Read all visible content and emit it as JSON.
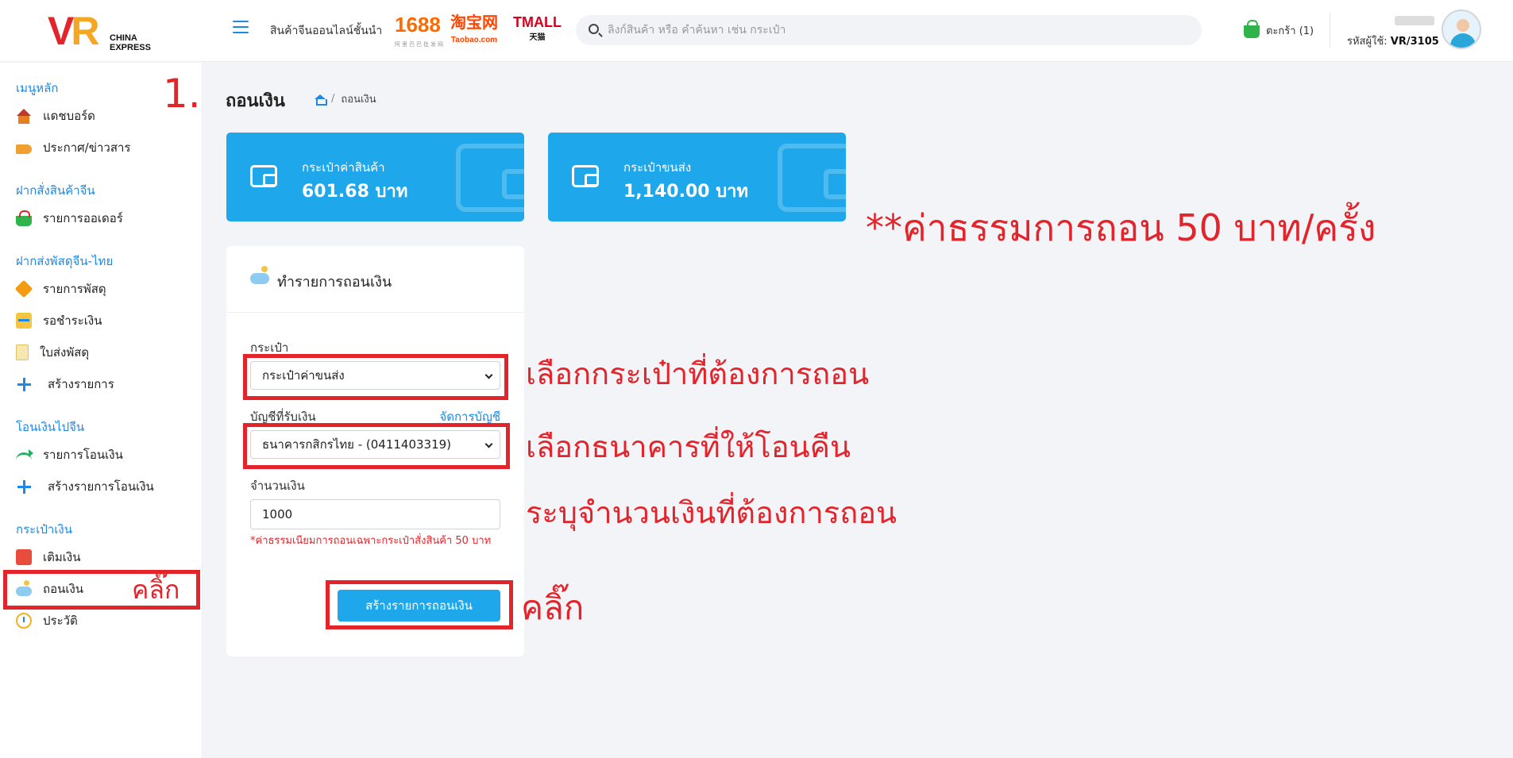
{
  "header": {
    "logo_mark": "VR",
    "logo_line1": "CHINA",
    "logo_line2": "EXPRESS",
    "tagline": "สินค้าจีนออนไลน์ชั้นนำ",
    "brands": [
      {
        "name": "1688",
        "sub": "阿里巴巴批发网"
      },
      {
        "name": "淘宝网",
        "sub": "Taobao.com"
      },
      {
        "name": "TMALL",
        "sub": "天猫"
      }
    ],
    "search_placeholder": "ลิงก์สินค้า หรือ คำค้นหา เช่น กระเป๋า",
    "cart_label": "ตะกร้า (1)",
    "user_code_label": "รหัสผู้ใช้:",
    "user_code": "VR/3105"
  },
  "sidebar": {
    "sections": [
      {
        "title": "เมนูหลัก",
        "items": [
          "แดชบอร์ด",
          "ประกาศ/ข่าวสาร"
        ]
      },
      {
        "title": "ฝากสั่งสินค้าจีน",
        "items": [
          "รายการออเดอร์"
        ]
      },
      {
        "title": "ฝากส่งพัสดุจีน-ไทย",
        "items": [
          "รายการพัสดุ",
          "รอชำระเงิน",
          "ใบส่งพัสดุ",
          "สร้างรายการ"
        ]
      },
      {
        "title": "โอนเงินไปจีน",
        "items": [
          "รายการโอนเงิน",
          "สร้างรายการโอนเงิน"
        ]
      },
      {
        "title": "กระเป๋าเงิน",
        "items": [
          "เติมเงิน",
          "ถอนเงิน",
          "ประวัติ"
        ]
      }
    ]
  },
  "main": {
    "page_title": "ถอนเงิน",
    "breadcrumb_current": "ถอนเงิน",
    "breadcrumb_sep": "/",
    "wallets": [
      {
        "label": "กระเป๋าค่าสินค้า",
        "amount": "601.68 บาท"
      },
      {
        "label": "กระเป๋าขนส่ง",
        "amount": "1,140.00 บาท"
      }
    ],
    "form": {
      "title": "ทำรายการถอนเงิน",
      "wallet_label": "กระเป๋า",
      "wallet_value": "กระเป๋าค่าขนส่ง",
      "account_label": "บัญชีที่รับเงิน",
      "manage_accounts": "จัดการบัญชี",
      "account_value": "ธนาคารกสิกรไทย - (0411403319)",
      "amount_label": "จำนวนเงิน",
      "amount_value": "1000",
      "fee_note": "*ค่าธรรมเนียมการถอนเฉพาะกระเป๋าสั่งสินค้า 50 บาท",
      "submit_label": "สร้างรายการถอนเงิน"
    }
  },
  "annotations": {
    "step": "1.",
    "click_sidebar": "คลิ๊ก",
    "fee": "**ค่าธรรมการถอน 50 บาท/ครั้ง",
    "choose_wallet": "เลือกกระเป๋าที่ต้องการถอน",
    "choose_bank": "เลือกธนาคารที่ให้โอนคืน",
    "enter_amount": "ระบุจำนวนเงินที่ต้องการถอน",
    "click_submit": "คลิ๊ก",
    "color": "#e3242b"
  }
}
